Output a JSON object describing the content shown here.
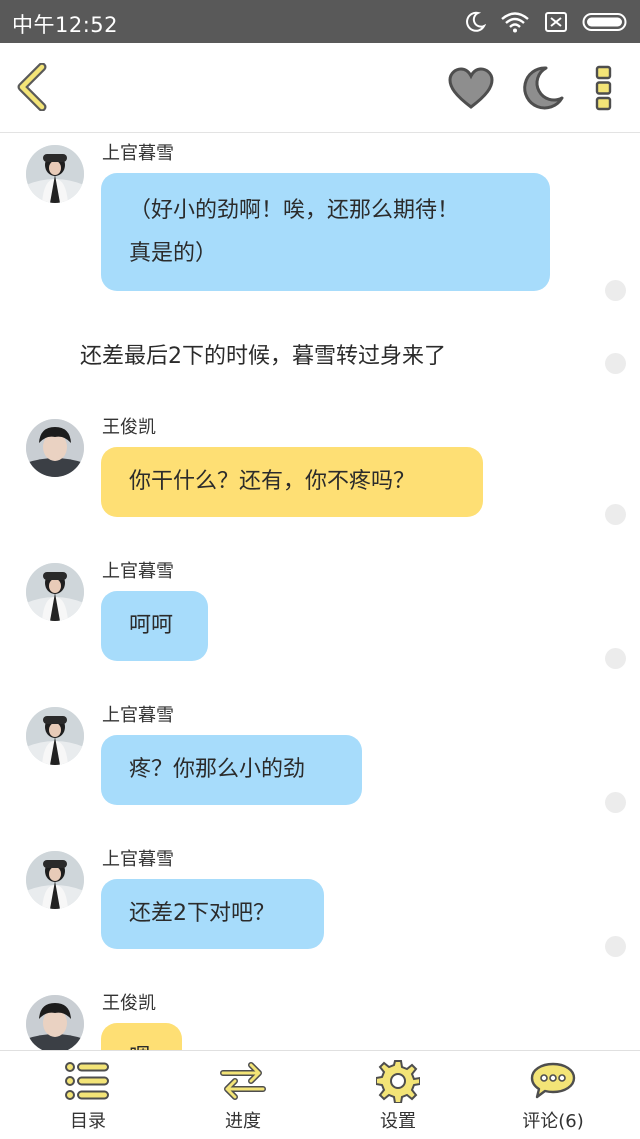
{
  "status_bar": {
    "time": "中午12:52"
  },
  "header": {
    "back_icon": "chevron-left-icon",
    "heart_icon": "heart-icon",
    "moon_icon": "moon-icon",
    "more_icon": "more-vertical-icon"
  },
  "messages": [
    {
      "type": "chat",
      "sender": "上官暮雪",
      "text_line1": "（好小的劲啊！唉，还那么期待！",
      "text_line2": "真是的）",
      "color": "#a7dcfb"
    },
    {
      "type": "narration",
      "text": "还差最后2下的时候，暮雪转过身来了"
    },
    {
      "type": "chat",
      "sender": "王俊凯",
      "text": "你干什么？还有，你不疼吗？",
      "color": "#fedf74"
    },
    {
      "type": "chat",
      "sender": "上官暮雪",
      "text": "呵呵",
      "color": "#a7dcfb"
    },
    {
      "type": "chat",
      "sender": "上官暮雪",
      "text": "疼？你那么小的劲",
      "color": "#a7dcfb"
    },
    {
      "type": "chat",
      "sender": "上官暮雪",
      "text": "还差2下对吧？",
      "color": "#a7dcfb"
    },
    {
      "type": "chat",
      "sender": "王俊凯",
      "text": "嗯",
      "color": "#fedf74"
    }
  ],
  "bottom_nav": [
    {
      "label": "目录",
      "icon": "list-icon"
    },
    {
      "label": "进度",
      "icon": "swap-arrows-icon"
    },
    {
      "label": "设置",
      "icon": "gear-icon"
    },
    {
      "label": "评论(6)",
      "icon": "comment-icon"
    }
  ],
  "colors": {
    "accent_yellow": "#fedf74",
    "bubble_blue": "#a7dcfb",
    "status_bar": "#595959"
  }
}
